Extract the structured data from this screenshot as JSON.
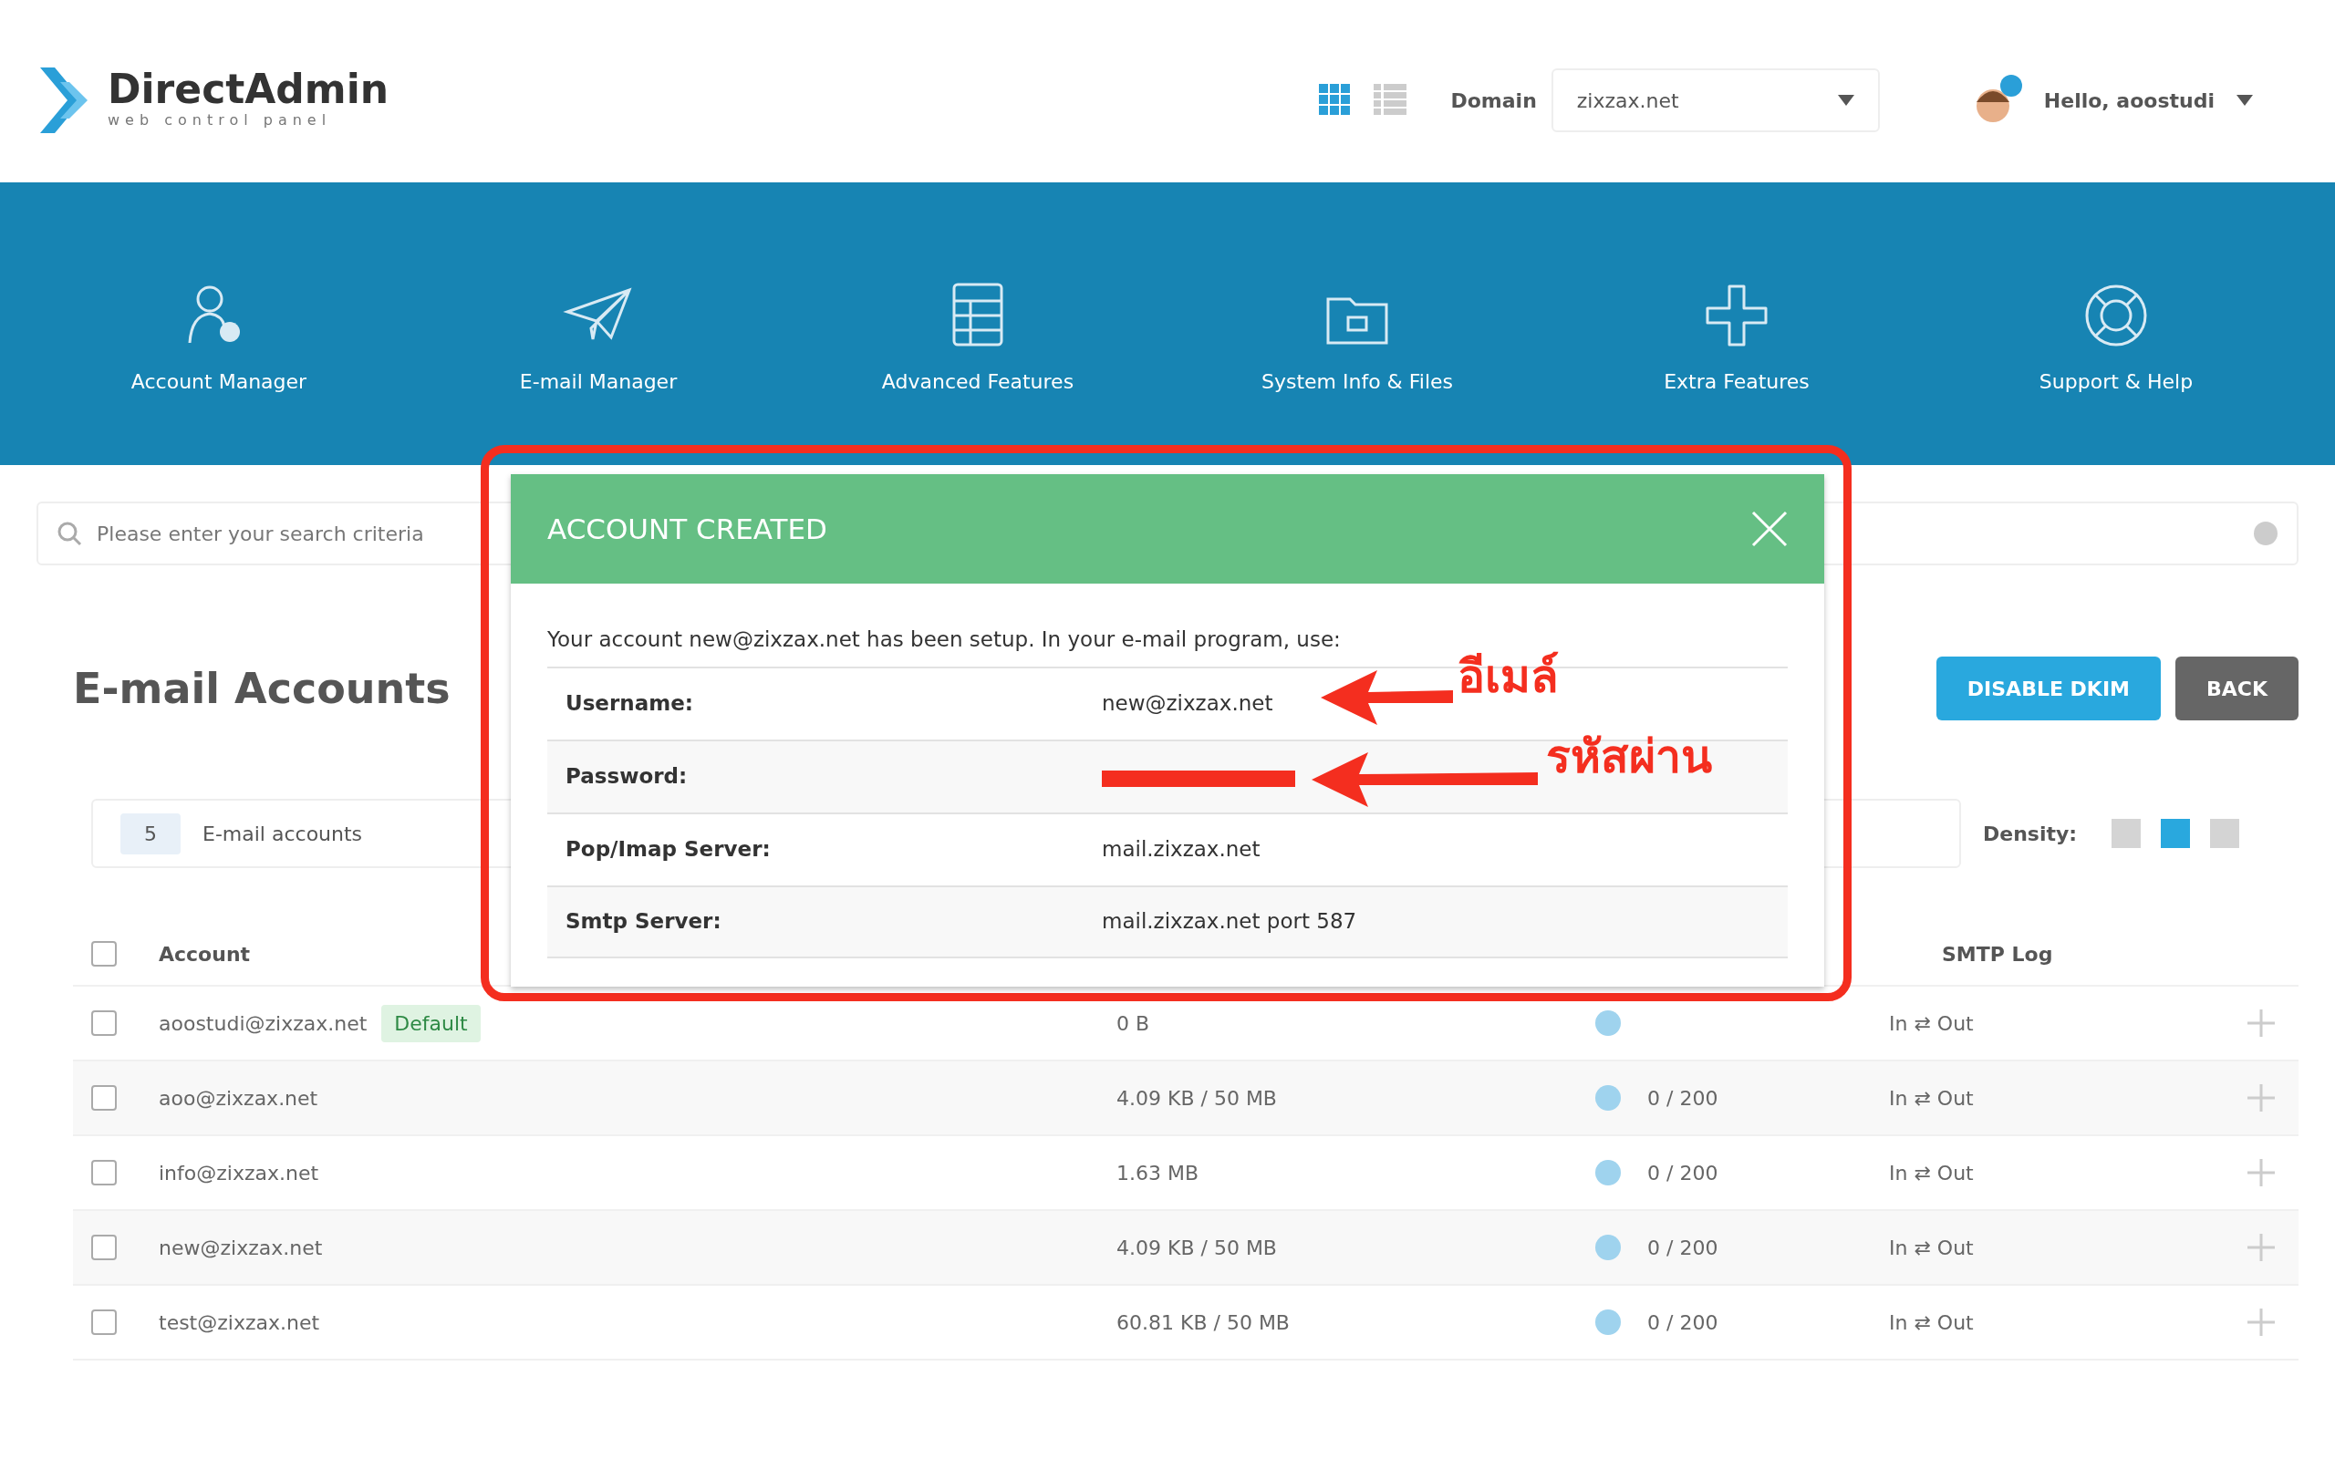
{
  "header": {
    "logo": {
      "name": "DirectAdmin",
      "tagline": "web control panel"
    },
    "view_toggles": [
      {
        "selected": true
      },
      {
        "selected": false
      }
    ],
    "domain": {
      "label": "Domain",
      "value": "zixzax.net"
    },
    "user": {
      "greeting": "Hello, aoostudi"
    }
  },
  "nav": [
    {
      "label": "Account Manager",
      "kind": "users"
    },
    {
      "label": "E-mail Manager",
      "kind": "plane"
    },
    {
      "label": "Advanced Features",
      "kind": "server"
    },
    {
      "label": "System Info & Files",
      "kind": "folder"
    },
    {
      "label": "Extra Features",
      "kind": "plus"
    },
    {
      "label": "Support & Help",
      "kind": "lifebuoy"
    }
  ],
  "search": {
    "placeholder": "Please enter your search criteria"
  },
  "page_title": "E-mail Accounts",
  "buttons": [
    {
      "label": "DISABLE DKIM",
      "kind": "primary"
    },
    {
      "label": "BACK",
      "kind": "secondary"
    }
  ],
  "summary": {
    "count": "5",
    "label": "E-mail accounts"
  },
  "density": {
    "label": "Density:",
    "options": [
      {
        "selected": false
      },
      {
        "selected": true
      },
      {
        "selected": false
      }
    ]
  },
  "table": {
    "columns": [
      "Account",
      "SMTP Log"
    ],
    "all_checked": false,
    "rows": [
      {
        "checked": false,
        "account": "aoostudi@zixzax.net",
        "badge": "Default",
        "usage": "0 B",
        "smtp_log": "In ⇄ Out"
      },
      {
        "checked": false,
        "account": "aoo@zixzax.net",
        "usage": "4.09 KB / 50 MB",
        "quota": "0 / 200",
        "smtp_log": "In ⇄ Out"
      },
      {
        "checked": false,
        "account": "info@zixzax.net",
        "usage": "1.63 MB",
        "quota": "0 / 200",
        "smtp_log": "In ⇄ Out"
      },
      {
        "checked": false,
        "account": "new@zixzax.net",
        "usage": "4.09 KB / 50 MB",
        "quota": "0 / 200",
        "smtp_log": "In ⇄ Out"
      },
      {
        "checked": false,
        "account": "test@zixzax.net",
        "usage": "60.81 KB / 50 MB",
        "quota": "0 / 200",
        "smtp_log": "In ⇄ Out"
      }
    ]
  },
  "dialog": {
    "title": "ACCOUNT CREATED",
    "message": "Your account new@zixzax.net has been setup. In your e-mail program, use:",
    "rows": [
      {
        "label": "Username:",
        "value": "new@zixzax.net"
      },
      {
        "label": "Password:",
        "redacted": true
      },
      {
        "label": "Pop/Imap Server:",
        "value": "mail.zixzax.net"
      },
      {
        "label": "Smtp Server:",
        "value": "mail.zixzax.net port 587"
      }
    ]
  },
  "annotations": [
    {
      "text": "อีเมล์"
    },
    {
      "text": "รหัสผ่าน"
    }
  ]
}
